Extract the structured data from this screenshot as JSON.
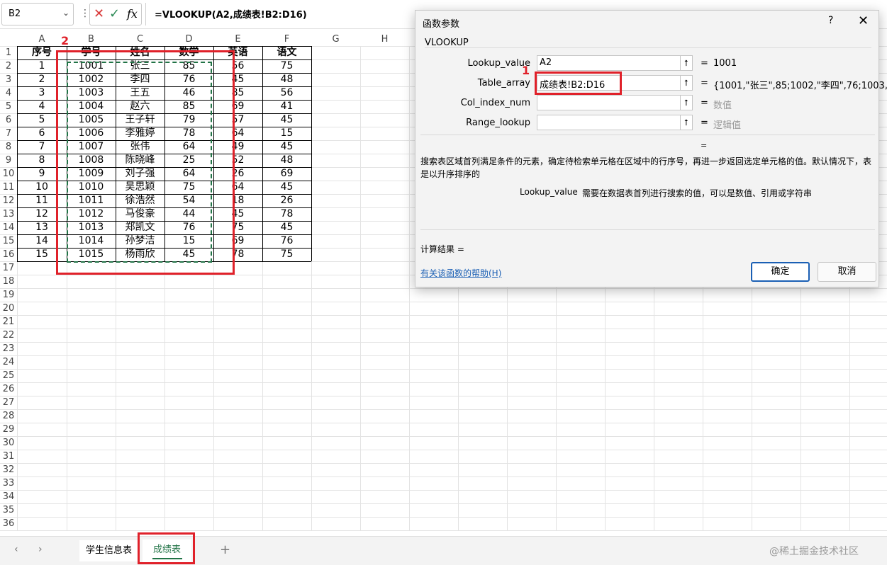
{
  "formula_bar": {
    "name_box": "B2",
    "cancel_icon": "✕",
    "enter_icon": "✓",
    "fx_label": "fx",
    "formula": "=VLOOKUP(A2,成绩表!B2:D16)"
  },
  "sheet": {
    "columns": [
      "A",
      "B",
      "C",
      "D",
      "E",
      "F",
      "G",
      "H"
    ],
    "headers": [
      "序号",
      "学号",
      "姓名",
      "数学",
      "英语",
      "语文"
    ],
    "rows": [
      [
        "1",
        "1001",
        "张三",
        "85",
        "56",
        "75"
      ],
      [
        "2",
        "1002",
        "李四",
        "76",
        "45",
        "48"
      ],
      [
        "3",
        "1003",
        "王五",
        "46",
        "85",
        "56"
      ],
      [
        "4",
        "1004",
        "赵六",
        "85",
        "69",
        "41"
      ],
      [
        "5",
        "1005",
        "王子轩",
        "79",
        "57",
        "45"
      ],
      [
        "6",
        "1006",
        "李雅婷",
        "78",
        "64",
        "15"
      ],
      [
        "7",
        "1007",
        "张伟",
        "64",
        "49",
        "45"
      ],
      [
        "8",
        "1008",
        "陈晓峰",
        "25",
        "52",
        "48"
      ],
      [
        "9",
        "1009",
        "刘子强",
        "64",
        "26",
        "69"
      ],
      [
        "10",
        "1010",
        "吴思颖",
        "75",
        "64",
        "45"
      ],
      [
        "11",
        "1011",
        "徐浩然",
        "54",
        "18",
        "26"
      ],
      [
        "12",
        "1012",
        "马俊豪",
        "44",
        "45",
        "78"
      ],
      [
        "13",
        "1013",
        "郑凯文",
        "76",
        "75",
        "45"
      ],
      [
        "14",
        "1014",
        "孙梦洁",
        "15",
        "69",
        "76"
      ],
      [
        "15",
        "1015",
        "杨雨欣",
        "45",
        "78",
        "75"
      ]
    ],
    "row_count": 36
  },
  "annotations": {
    "label1": "1",
    "label2": "2"
  },
  "dialog": {
    "title": "函数参数",
    "help": "?",
    "close": "✕",
    "function_name": "VLOOKUP",
    "args": [
      {
        "label": "Lookup_value",
        "value": "A2",
        "result": "1001",
        "gray": false
      },
      {
        "label": "Table_array",
        "value": "成绩表!B2:D16",
        "result": "{1001,\"张三\",85;1002,\"李四\",76;1003,...",
        "gray": false
      },
      {
        "label": "Col_index_num",
        "value": "",
        "result": "数值",
        "gray": true
      },
      {
        "label": "Range_lookup",
        "value": "",
        "result": "逻辑值",
        "gray": true
      }
    ],
    "equals": "=",
    "description": "搜索表区域首列满足条件的元素，确定待检索单元格在区域中的行序号，再进一步返回选定单元格的值。默认情况下，表是以升序排序的",
    "arg_desc_name": "Lookup_value",
    "arg_desc_text": "需要在数据表首列进行搜索的值，可以是数值、引用或字符串",
    "calc_result": "计算结果 =",
    "help_link": "有关该函数的帮助(H)",
    "ok": "确定",
    "cancel": "取消"
  },
  "tabs": {
    "prev": "‹",
    "next": "›",
    "sheet1": "学生信息表",
    "sheet2": "成绩表",
    "add": "+",
    "watermark": "@稀土掘金技术社区"
  }
}
